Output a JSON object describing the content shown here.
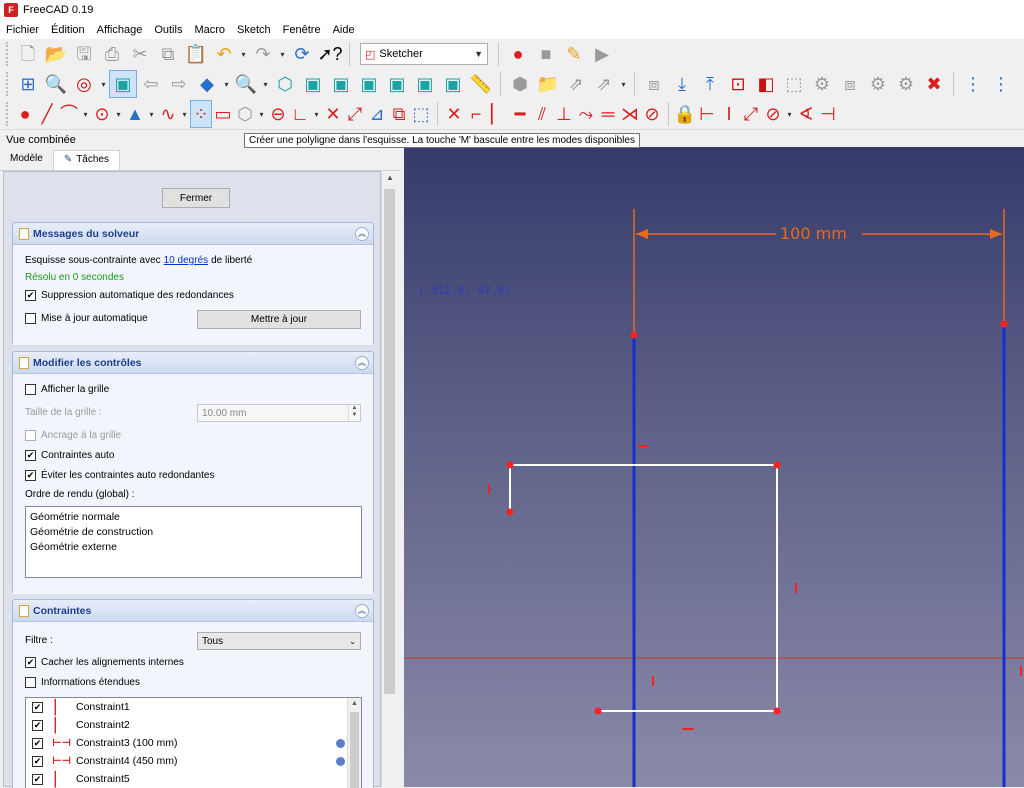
{
  "app": {
    "title": "FreeCAD 0.19"
  },
  "menu": [
    "Fichier",
    "Édition",
    "Affichage",
    "Outils",
    "Macro",
    "Sketch",
    "Fenêtre",
    "Aide"
  ],
  "toolbar": {
    "workbench": "Sketcher"
  },
  "tooltip": "Créer une polyligne dans l'esquisse. La touche 'M' bascule entre les modes disponibles",
  "panel": {
    "title": "Vue combinée",
    "tabs": [
      "Modèle",
      "Tâches"
    ],
    "close_label": "Fermer",
    "solver": {
      "title": "Messages du solveur",
      "status_prefix": "Esquisse sous-contrainte avec",
      "status_link": "10 degrés",
      "status_suffix": "de liberté",
      "solved": "Résolu en 0 secondes",
      "auto_remove": "Suppression automatique des redondances",
      "auto_update": "Mise à jour automatique",
      "update_button": "Mettre à jour"
    },
    "controls": {
      "title": "Modifier les contrôles",
      "show_grid": "Afficher la grille",
      "grid_size_label": "Taille de la grille :",
      "grid_size_value": "10.00 mm",
      "grid_snap": "Ancrage à la grille",
      "auto_constraints": "Contraintes auto",
      "avoid_redundant": "Éviter les contraintes auto redondantes",
      "render_order_label": "Ordre de rendu (global) :",
      "render_order": [
        "Géométrie normale",
        "Géométrie de construction",
        "Géométrie externe"
      ]
    },
    "constraints": {
      "title": "Contraintes",
      "filter_label": "Filtre :",
      "filter_value": "Tous",
      "hide_internal": "Cacher les alignements internes",
      "extended_info": "Informations étendues",
      "items": [
        {
          "name": "Constraint1",
          "icon": "vertical-constraint-icon"
        },
        {
          "name": "Constraint2",
          "icon": "vertical-constraint-icon"
        },
        {
          "name": "Constraint3 (100 mm)",
          "icon": "horizontal-distance-icon"
        },
        {
          "name": "Constraint4 (450 mm)",
          "icon": "horizontal-distance-icon"
        },
        {
          "name": "Constraint5",
          "icon": "vertical-constraint-icon"
        }
      ]
    }
  },
  "viewport": {
    "cursor_coords": "(-512.0, 97.8)",
    "dimension_label": "100 mm"
  },
  "colors": {
    "sketch_line": "#ffffff",
    "axis_line": "#1530d0",
    "dimension": "#e86a1a",
    "vertex": "#ff2020"
  }
}
